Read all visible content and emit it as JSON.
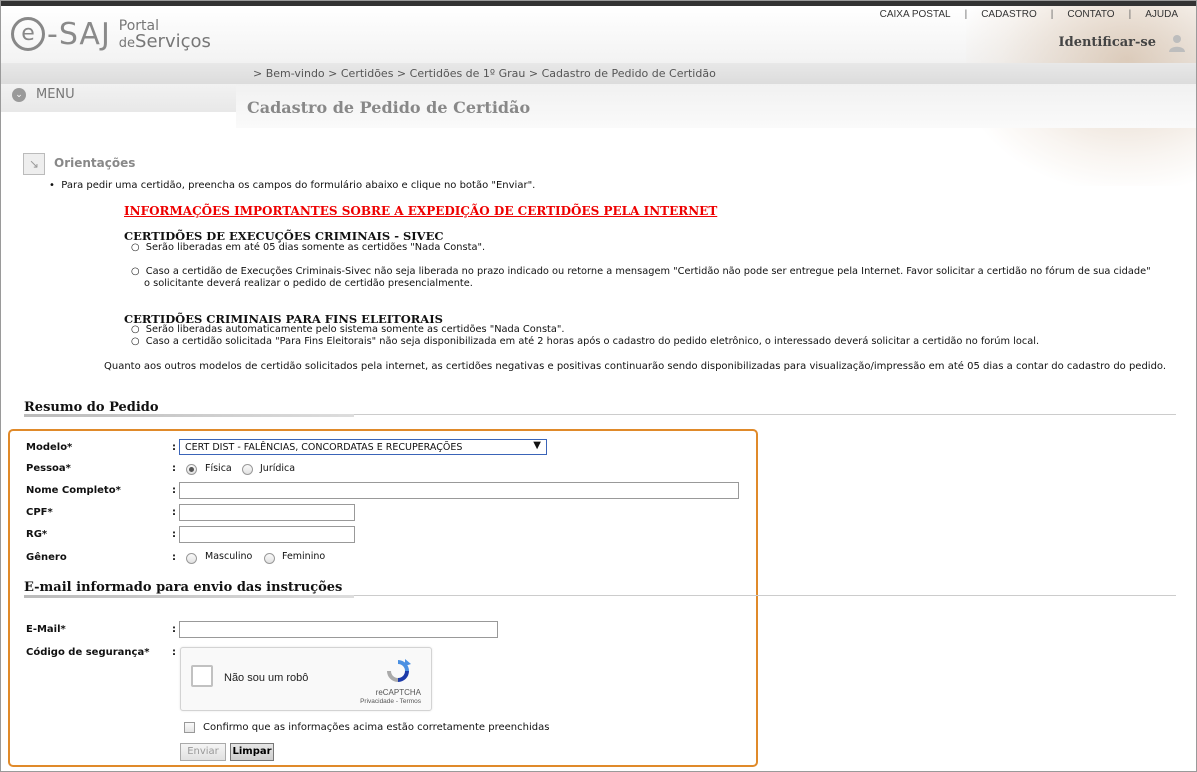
{
  "logo": {
    "e": "e",
    "saj": "-SAJ",
    "portal": "Portal",
    "de": "de",
    "servicos": "Serviços"
  },
  "topnav": [
    "CAIXA POSTAL",
    "CADASTRO",
    "CONTATO",
    "AJUDA"
  ],
  "identificar": "Identificar-se",
  "breadcrumb": "> Bem-vindo > Certidões > Certidões de 1º Grau > Cadastro de Pedido de Certidão",
  "menu_label": "MENU",
  "page_title": "Cadastro de Pedido de Certidão",
  "orientacoes": {
    "title": "Orientações",
    "bullet": "Para pedir uma certidão, preencha os campos do formulário abaixo e clique no botão \"Enviar\".",
    "important_link": "INFORMAÇÕES IMPORTANTES SOBRE A EXPEDIÇÃO DE CERTIDÕES PELA INTERNET",
    "sivec_title": "CERTIDÕES DE EXECUÇÕES CRIMINAIS - SIVEC",
    "sivec_items": [
      "Serão liberadas em até 05 dias somente as certidões \"Nada Consta\".",
      "Caso a certidão de Execuções Criminais-Sivec não seja liberada no prazo indicado ou retorne a mensagem \"Certidão não pode ser entregue pela Internet. Favor solicitar a certidão no fórum de sua cidade\"",
      "o solicitante deverá realizar o pedido de certidão presencialmente."
    ],
    "eleitorais_title": "CERTIDÕES CRIMINAIS PARA FINS ELEITORAIS",
    "eleitorais_items": [
      "Serão liberadas automaticamente pelo sistema somente as certidões \"Nada Consta\".",
      "Caso a certidão solicitada \"Para Fins Eleitorais\" não seja disponibilizada em até 2 horas após o cadastro do pedido eletrônico, o interessado deverá solicitar a certidão no forúm local."
    ],
    "note": "Quanto aos outros modelos de certidão solicitados pela internet, as certidões negativas e positivas continuarão sendo disponibilizadas para visualização/impressão em até 05 dias a contar do cadastro do pedido."
  },
  "resumo_title": "Resumo do Pedido",
  "form": {
    "modelo_label": "Modelo*",
    "modelo_value": "CERT DIST - FALÊNCIAS, CONCORDATAS E RECUPERAÇÕES",
    "pessoa_label": "Pessoa*",
    "pessoa_options": [
      "Física",
      "Jurídica"
    ],
    "pessoa_selected": "Física",
    "nome_label": "Nome Completo*",
    "cpf_label": "CPF*",
    "rg_label": "RG*",
    "genero_label": "Gênero",
    "genero_options": [
      "Masculino",
      "Feminino"
    ],
    "colon": ":"
  },
  "email_section_title": "E-mail informado para envio das instruções",
  "email_label": "E-Mail*",
  "codigo_label": "Código de segurança*",
  "captcha": {
    "text": "Não sou um robô",
    "brand": "reCAPTCHA",
    "terms": "Privacidade - Termos"
  },
  "confirm_label": "Confirmo que as informações acima estão corretamente preenchidas",
  "buttons": {
    "enviar": "Enviar",
    "limpar": "Limpar"
  },
  "colors": {
    "accent_orange": "#e08a2a",
    "link_red": "#e00000",
    "select_border": "#3a64b8"
  }
}
